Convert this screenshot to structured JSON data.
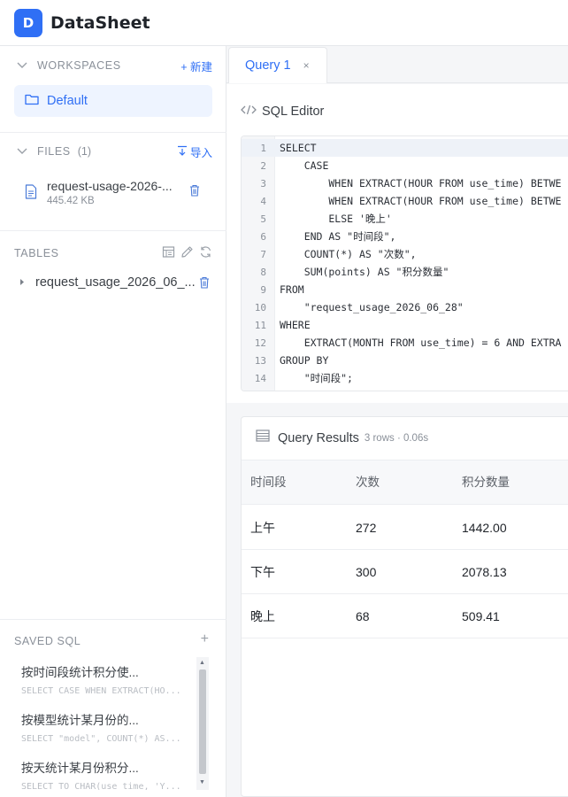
{
  "app": {
    "logo_letter": "D",
    "title": "DataSheet"
  },
  "sidebar": {
    "workspaces": {
      "label": "WORKSPACES",
      "action": "+ 新建",
      "items": [
        {
          "label": "Default"
        }
      ]
    },
    "files": {
      "label": "FILES",
      "count": "(1)",
      "action": "导入",
      "items": [
        {
          "name": "request-usage-2026-...",
          "size": "445.42 KB"
        }
      ]
    },
    "tables": {
      "label": "TABLES",
      "items": [
        {
          "name": "request_usage_2026_06_..."
        }
      ]
    },
    "saved_sql": {
      "label": "SAVED SQL",
      "add": "+",
      "items": [
        {
          "title": "按时间段统计积分使...",
          "sql": "SELECT CASE WHEN EXTRACT(HO..."
        },
        {
          "title": "按模型统计某月份的...",
          "sql": "SELECT \"model\", COUNT(*) AS..."
        },
        {
          "title": "按天统计某月份积分...",
          "sql": "SELECT TO_CHAR(use_time, 'Y..."
        }
      ]
    }
  },
  "tabs": [
    {
      "label": "Query 1",
      "close": "×"
    }
  ],
  "editor": {
    "title": "SQL Editor",
    "lines": [
      {
        "n": "1",
        "text": "SELECT"
      },
      {
        "n": "2",
        "text": "    CASE"
      },
      {
        "n": "3",
        "text": "        WHEN EXTRACT(HOUR FROM use_time) BETWE"
      },
      {
        "n": "4",
        "text": "        WHEN EXTRACT(HOUR FROM use_time) BETWE"
      },
      {
        "n": "5",
        "text": "        ELSE '晚上'"
      },
      {
        "n": "6",
        "text": "    END AS \"时间段\","
      },
      {
        "n": "7",
        "text": "    COUNT(*) AS \"次数\","
      },
      {
        "n": "8",
        "text": "    SUM(points) AS \"积分数量\""
      },
      {
        "n": "9",
        "text": "FROM"
      },
      {
        "n": "10",
        "text": "    \"request_usage_2026_06_28\""
      },
      {
        "n": "11",
        "text": "WHERE"
      },
      {
        "n": "12",
        "text": "    EXTRACT(MONTH FROM use_time) = 6 AND EXTRA"
      },
      {
        "n": "13",
        "text": "GROUP BY"
      },
      {
        "n": "14",
        "text": "    \"时间段\";"
      }
    ]
  },
  "results": {
    "title": "Query Results",
    "meta": "3 rows · 0.06s",
    "columns": [
      "时间段",
      "次数",
      "积分数量"
    ],
    "rows": [
      [
        "上午",
        "272",
        "1442.00"
      ],
      [
        "下午",
        "300",
        "2078.13"
      ],
      [
        "晚上",
        "68",
        "509.41"
      ]
    ]
  },
  "colors": {
    "accent": "#2f6ff5",
    "keyword": "#7a1f7a",
    "string": "#2a51b5"
  }
}
